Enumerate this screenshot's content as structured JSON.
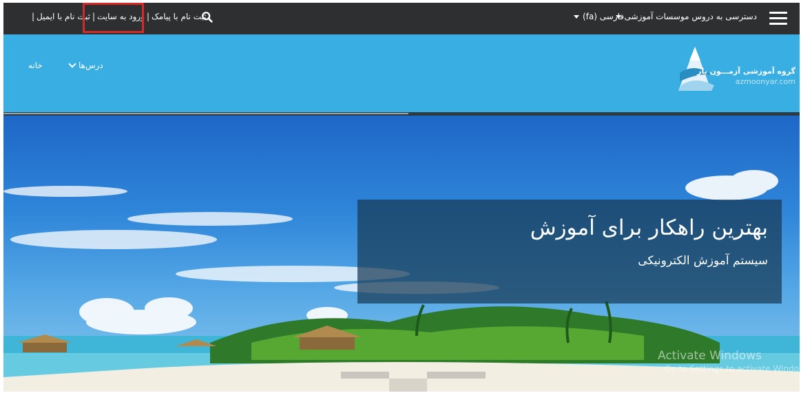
{
  "topbar": {
    "menu_access": "دسترسی به دروس موسسات آموزشی",
    "language": "فارسی (fa)",
    "links": {
      "sep": "|",
      "register_email": "ثبت نام با ایمیل",
      "login": "ورود به سایت",
      "register_sms": "ثبت نام با پیامک"
    }
  },
  "header": {
    "logo_text": "گروه آموزشی آزمـــون یار",
    "logo_url_text": "azmoonyar.com",
    "nav": {
      "home": "خانه",
      "courses": "درس‌ها"
    }
  },
  "hero": {
    "title": "بهترین راهکار برای آموزش",
    "subtitle": "سیستم آموزش الکترونیکی",
    "watermark_title": "Activate Windows",
    "watermark_sub": "Go to Settings to activate Windows."
  },
  "colors": {
    "topbar": "#2e2f31",
    "band": "#38aee3",
    "highlight": "#d42a2a",
    "overlay": "#183a54"
  }
}
